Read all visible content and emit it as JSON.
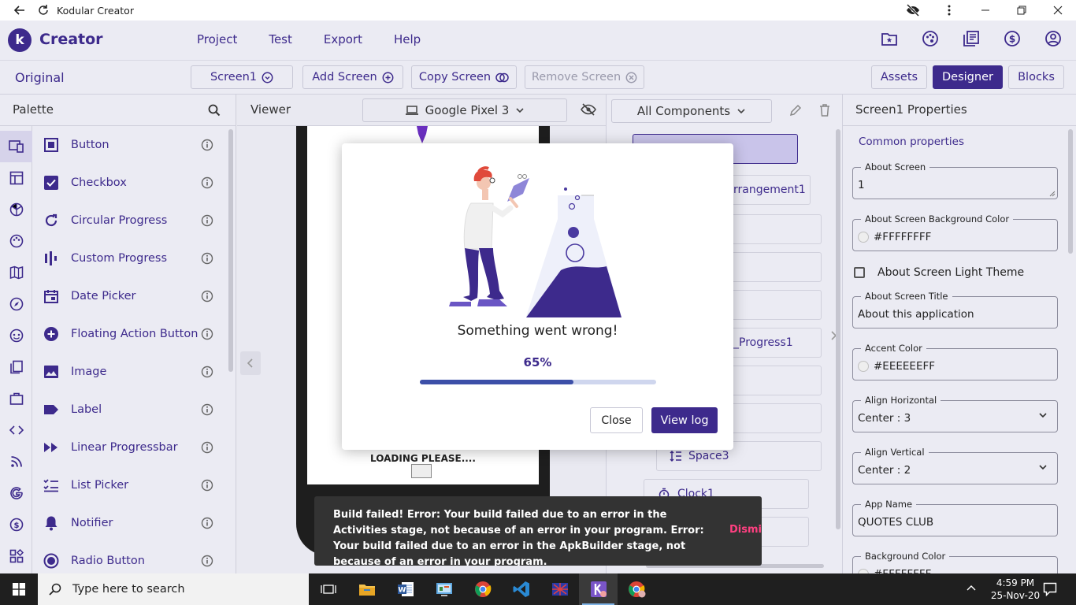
{
  "window": {
    "title": "Kodular Creator"
  },
  "header": {
    "brand": "Creator",
    "logo_letter": "k",
    "menu": [
      "Project",
      "Test",
      "Export",
      "Help"
    ]
  },
  "toolbar": {
    "project_name": "Original",
    "screen_select": "Screen1",
    "add_screen": "Add Screen",
    "copy_screen": "Copy Screen",
    "remove_screen": "Remove Screen",
    "assets": "Assets",
    "designer": "Designer",
    "blocks": "Blocks"
  },
  "palette": {
    "title": "Palette",
    "items": [
      "Button",
      "Checkbox",
      "Circular Progress",
      "Custom Progress",
      "Date Picker",
      "Floating Action Button",
      "Image",
      "Label",
      "Linear Progressbar",
      "List Picker",
      "Notifier",
      "Radio Button"
    ]
  },
  "viewer": {
    "title": "Viewer",
    "device": "Google Pixel 3",
    "loading_text": "LOADING PLEASE...."
  },
  "components": {
    "filter": "All Components",
    "nodes": [
      "rrangement1",
      "_Progress1",
      "Space3",
      "Clock1"
    ]
  },
  "properties": {
    "title": "Screen1 Properties",
    "section": "Common properties",
    "about_screen": {
      "label": "About Screen",
      "value": "1"
    },
    "about_bg": {
      "label": "About Screen Background Color",
      "value": "#FFFFFFFF"
    },
    "light_theme": {
      "label": "About Screen Light Theme",
      "checked": false
    },
    "about_title": {
      "label": "About Screen Title",
      "value": "About this application"
    },
    "accent": {
      "label": "Accent Color",
      "value": "#EEEEEEFF"
    },
    "align_h": {
      "label": "Align Horizontal",
      "value": "Center : 3"
    },
    "align_v": {
      "label": "Align Vertical",
      "value": "Center : 2"
    },
    "app_name": {
      "label": "App Name",
      "value": "QUOTES CLUB"
    },
    "bg_color": {
      "label": "Background Color",
      "value": "#FFFFFFFF"
    }
  },
  "modal": {
    "message": "Something went wrong!",
    "progress_label": "65%",
    "progress": 0.65,
    "close": "Close",
    "view_log": "View log"
  },
  "snackbar": {
    "message": "Build failed! Error: Your build failed due to an error in the Activities stage, not because of an error in your program. Error: Your build failed due to an error in the ApkBuilder stage, not because of an error in your program.",
    "action": "Dismiss"
  },
  "taskbar": {
    "search_placeholder": "Type here to search",
    "time": "4:59 PM",
    "date": "25-Nov-20"
  },
  "colors": {
    "primary": "#3d2a8c",
    "accent_pink": "#ff4081",
    "progress": "#3c4fa8"
  }
}
